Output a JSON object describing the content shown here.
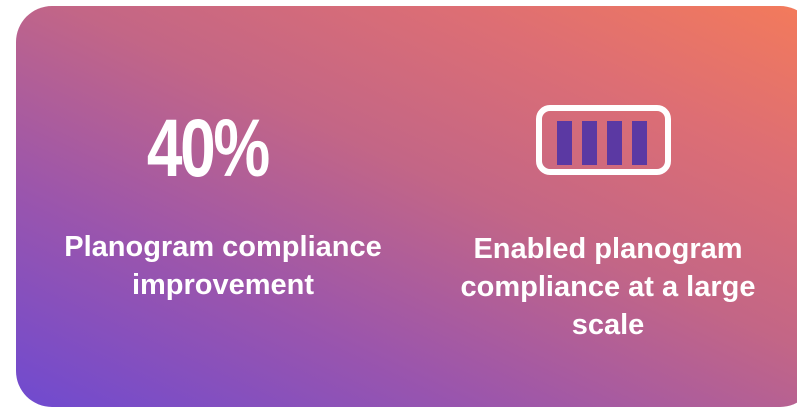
{
  "left": {
    "stat": "40%",
    "label_line1": "Planogram compliance",
    "label_line2": "improvement"
  },
  "right": {
    "icon": "battery-full-icon",
    "label_line1": "Enabled planogram",
    "label_line2": "compliance at a large",
    "label_line3": "scale"
  },
  "colors": {
    "gradient_start": "#6f4ad0",
    "gradient_end": "#f47b5a",
    "icon_fill": "#5b39a3",
    "text": "#ffffff"
  }
}
